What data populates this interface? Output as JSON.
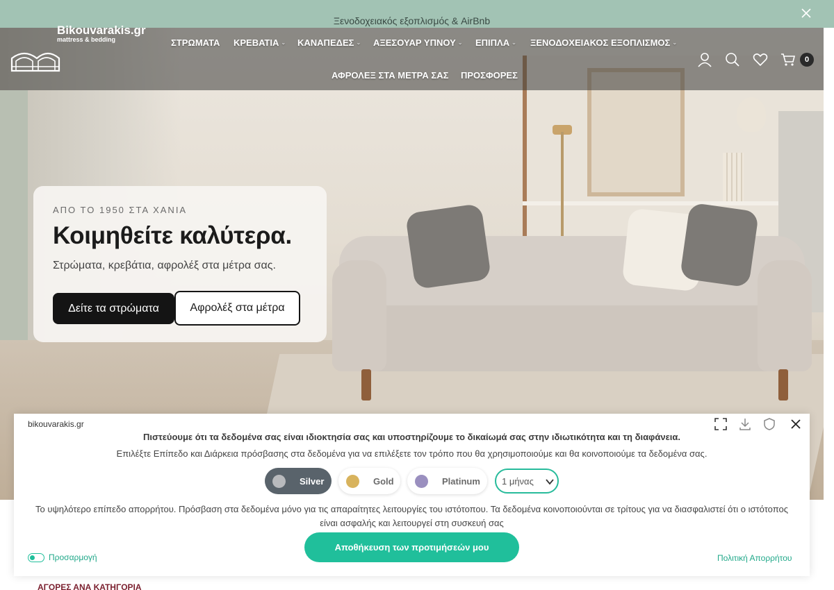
{
  "promo": {
    "text": "Ξενοδοχειακός εξοπλισμός & AirBnb",
    "close_icon": "close-icon"
  },
  "logo": {
    "name": "Bikouvarakis.gr",
    "tagline": "mattress & bedding"
  },
  "nav": {
    "items": [
      {
        "label": "ΣΤΡΩΜΑΤΑ",
        "has_submenu": false
      },
      {
        "label": "ΚΡΕΒΑΤΙΑ",
        "has_submenu": true
      },
      {
        "label": "ΚΑΝΑΠΕΔΕΣ",
        "has_submenu": true
      },
      {
        "label": "ΑΞΕΣΟΥΑΡ ΥΠΝΟΥ",
        "has_submenu": true
      },
      {
        "label": "ΕΠΙΠΛΑ",
        "has_submenu": true
      },
      {
        "label": "ΞΕΝΟΔΟΧΕΙΑΚΟΣ ΕΞΟΠΛΙΣΜΟΣ",
        "has_submenu": true
      },
      {
        "label": "ΑΦΡΟΛΕΞ ΣΤΑ ΜΕΤΡΑ ΣΑΣ",
        "has_submenu": false
      },
      {
        "label": "ΠΡΟΣΦΟΡΕΣ",
        "has_submenu": false
      }
    ],
    "chevron": "⌄"
  },
  "header_icons": [
    "user-icon",
    "search-icon",
    "heart-icon",
    "cart-icon"
  ],
  "cart": {
    "count": "0"
  },
  "hero": {
    "eyebrow": "ΑΠΟ ΤΟ 1950 ΣΤΑ ΧΑΝΙΑ",
    "title": "Κοιμηθείτε καλύτερα.",
    "subtitle": "Στρώματα, κρεβάτια, αφρολέξ στα μέτρα σας.",
    "primary_button": "Δείτε τα στρώματα",
    "secondary_button": "Αφρολέξ στα μέτρα"
  },
  "category_heading": "ΑΓΟΡΕΣ ΑΝΑ ΚΑΤΗΓΟΡΙΑ",
  "consent": {
    "domain": "bikouvarakis.gr",
    "tools": [
      "expand-icon",
      "download-icon",
      "shield-icon",
      "close-icon"
    ],
    "heading": "Πιστεύουμε ότι τα δεδομένα σας είναι ιδιοκτησία σας και υποστηρίζουμε το δικαίωμά σας στην ιδιωτικότητα και τη διαφάνεια.",
    "description": "Επιλέξτε Επίπεδο και Διάρκεια πρόσβασης στα δεδομένα για να επιλέξετε τον τρόπο που θα χρησιμοποιούμε και θα κοινοποιούμε τα δεδομένα σας.",
    "levels": [
      {
        "label": "Silver",
        "color": "#b8babd",
        "selected": true
      },
      {
        "label": "Gold",
        "color": "#d8b35d",
        "selected": false
      },
      {
        "label": "Platinum",
        "color": "#9a8fbf",
        "selected": false
      }
    ],
    "duration": {
      "value": "1 μήνας"
    },
    "note": "Το υψηλότερο επίπεδο απορρήτου. Πρόσβαση στα δεδομένα μόνο για τις απαραίτητες λειτουργίες του ιστότοπου. Τα δεδομένα κοινοποιούνται σε τρίτους για να διασφαλιστεί ότι ο ιστότοπος είναι ασφαλής και λειτουργεί στη συσκευή σας",
    "save_button": "Αποθήκευση των προτιμήσεών μου",
    "customize": "Προσαρμογή",
    "policy": "Πολιτική Απορρήτου"
  },
  "colors": {
    "accent": "#20bf9b",
    "promo_bg": "#a2c3b4",
    "dark": "#141414",
    "category_heading": "#7a1f2e"
  }
}
